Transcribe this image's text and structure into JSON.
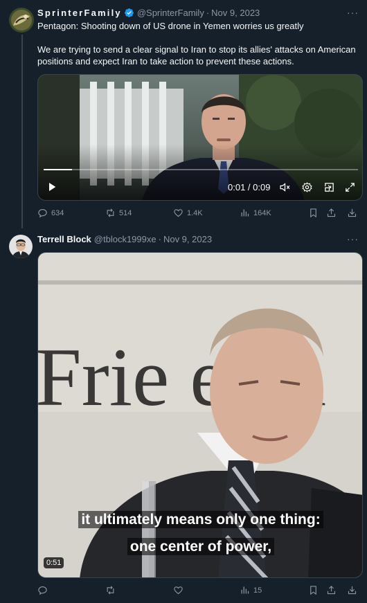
{
  "tweet1": {
    "name": "SprinterFamily",
    "handle": "@SprinterFamily",
    "separator": "·",
    "date": "Nov 9, 2023",
    "more": "···",
    "line1": "Pentagon: Shooting down of US drone in Yemen worries us greatly",
    "line2": "We are trying to send a clear signal to Iran to stop its allies' attacks on American positions and expect Iran to take action to prevent these actions.",
    "video": {
      "time": "0:01 / 0:09",
      "progress": 0.09
    },
    "stats": {
      "replies": "634",
      "reposts": "514",
      "likes": "1.4K",
      "views": "164K"
    }
  },
  "tweet2": {
    "name": "Terrell Block",
    "handle": "@tblock1999xe",
    "separator": "·",
    "date": "Nov 9, 2023",
    "more": "···",
    "video": {
      "subtitle1": "it ultimately means only one thing:",
      "subtitle2": "one center of power,",
      "duration": "0:51",
      "backdrop_text": "Frie e ch"
    },
    "stats": {
      "views": "15"
    }
  },
  "colors": {
    "background": "#15202b",
    "text": "#f7f9f9",
    "muted": "#8b98a5",
    "verified": "#1d9bf0",
    "border": "#38444d"
  },
  "icons": [
    "verified-badge-icon",
    "play-icon",
    "volume-icon",
    "settings-icon",
    "pip-icon",
    "fullscreen-icon",
    "reply-icon",
    "repost-icon",
    "like-icon",
    "views-icon",
    "bookmark-icon",
    "share-icon",
    "download-icon"
  ]
}
